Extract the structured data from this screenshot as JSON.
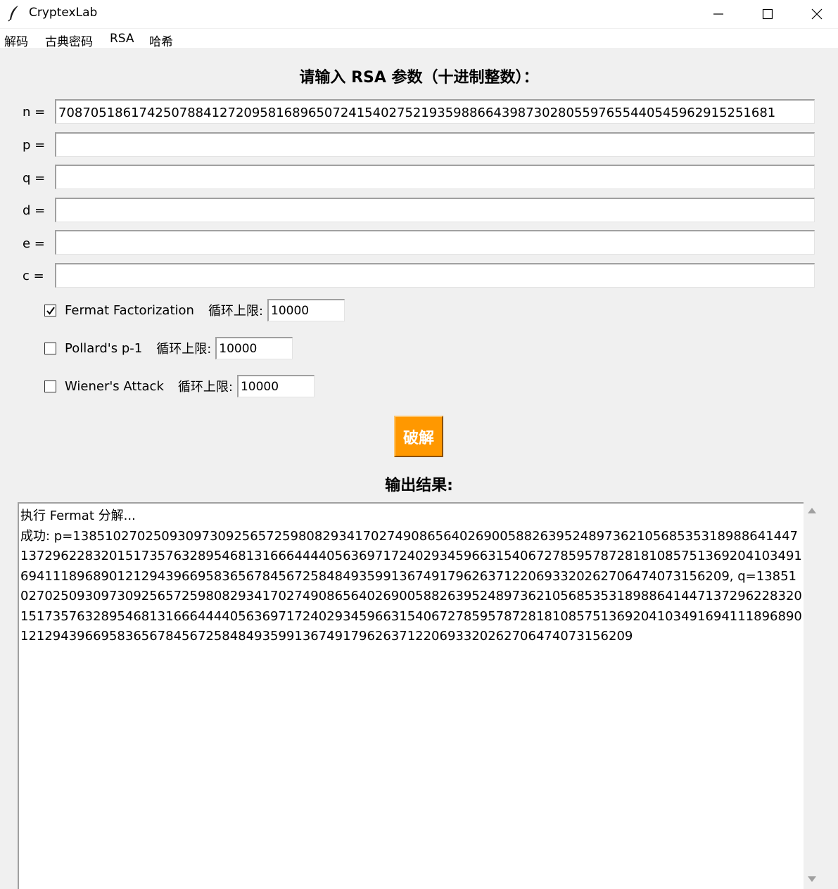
{
  "window": {
    "title": "CryptexLab",
    "app_icon": "feather-icon",
    "controls": [
      "minimize-icon",
      "maximize-icon",
      "close-icon"
    ]
  },
  "menu": {
    "items": [
      "解码",
      "古典密码",
      "RSA",
      "哈希"
    ]
  },
  "heading": "请输入 RSA 参数（十进制整数）：",
  "params": {
    "n": {
      "label": "n =",
      "value": "70870518617425078841272095816896507241540275219359886643987302805597655440545962915251681"
    },
    "p": {
      "label": "p =",
      "value": ""
    },
    "q": {
      "label": "q =",
      "value": ""
    },
    "d": {
      "label": "d =",
      "value": ""
    },
    "e": {
      "label": "e =",
      "value": ""
    },
    "c": {
      "label": "c =",
      "value": ""
    }
  },
  "algorithms": [
    {
      "name": "Fermat Factorization",
      "checked": true,
      "limit_label": "循环上限:",
      "limit": "10000"
    },
    {
      "name": "Pollard's p-1",
      "checked": false,
      "limit_label": "循环上限:",
      "limit": "10000"
    },
    {
      "name": "Wiener's Attack",
      "checked": false,
      "limit_label": "循环上限:",
      "limit": "10000"
    }
  ],
  "crack_button": "破解",
  "output_heading": "输出结果:",
  "output_text": "执行 Fermat 分解...\n成功: p=13851027025093097309256572598082934170274908656402690058826395248973621056853531898864144713729622832015173576328954681316664444056369717240293459663154067278595787281810857513692041034916941118968901212943966958365678456725848493599136749179626371220693320262706474073156209, q=13851027025093097309256572598082934170274908656402690058826395248973621056853531898864144713729622832015173576328954681316664444056369717240293459663154067278595787281810857513692041034916941118968901212943966958365678456725848493599136749179626371220693320262706474073156209",
  "colors": {
    "crack_button": "#ff9800",
    "background": "#f0f0f0"
  }
}
